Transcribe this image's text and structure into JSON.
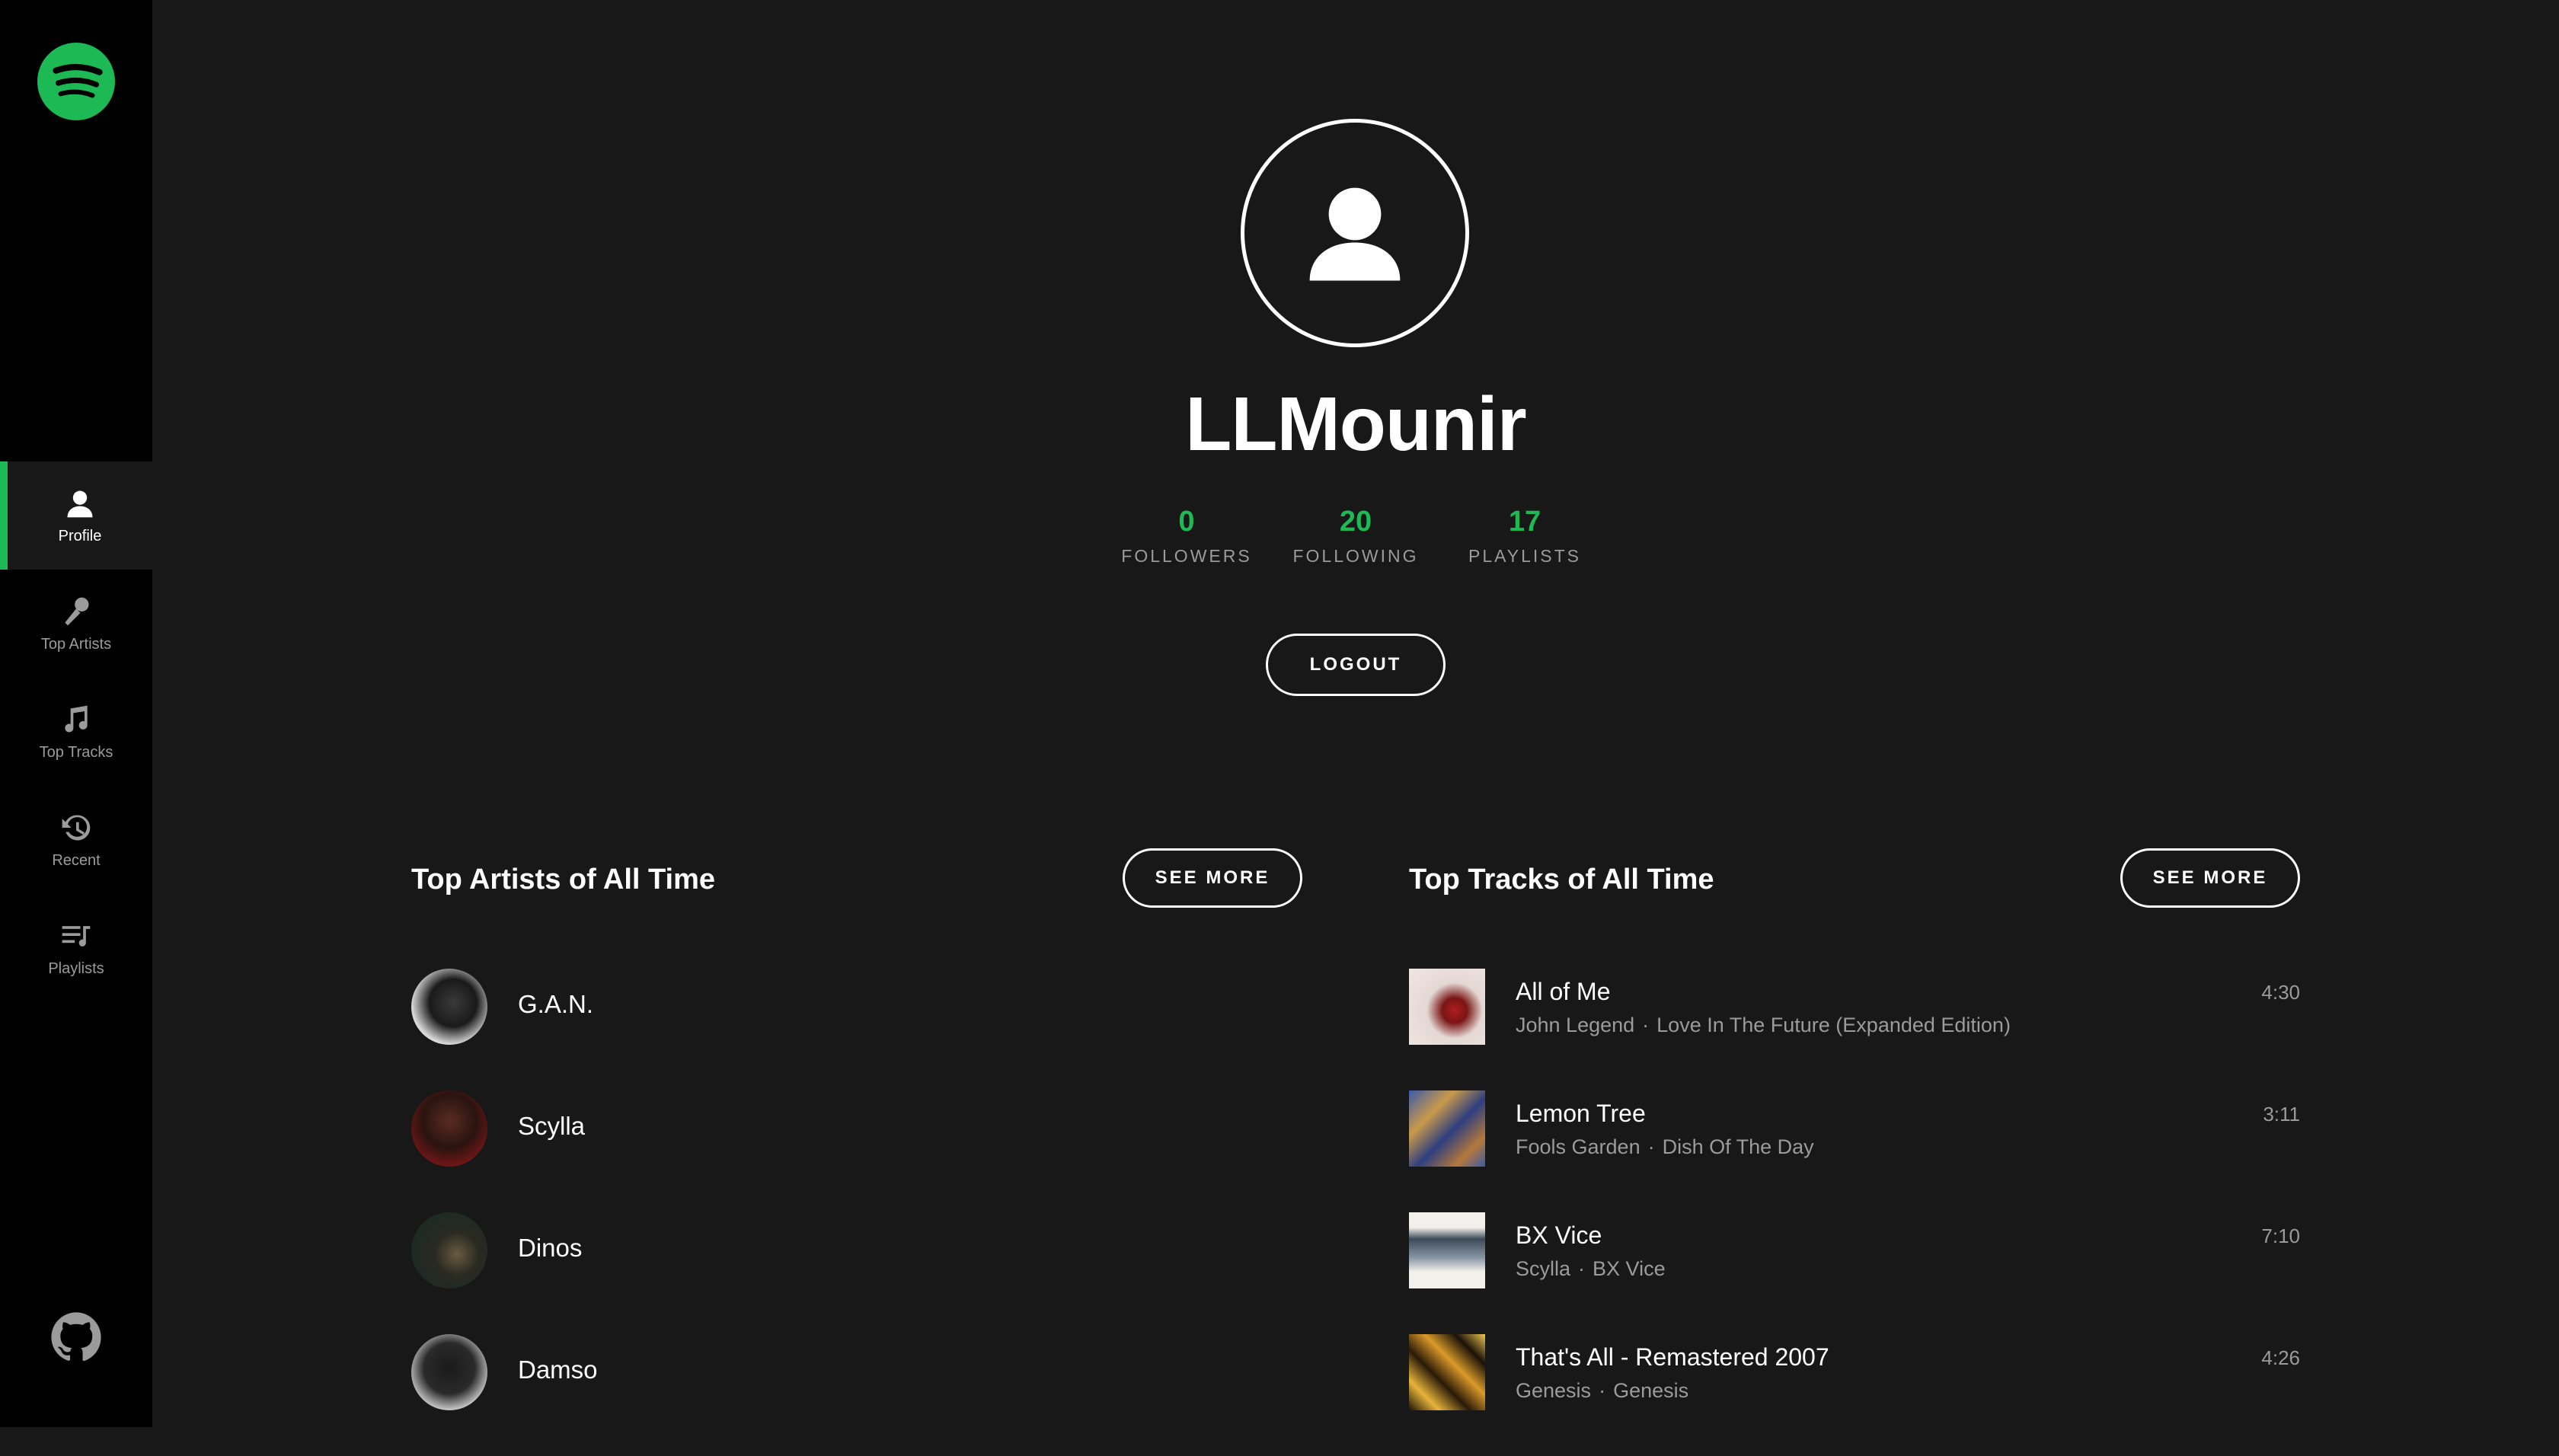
{
  "sidebar": {
    "items": [
      {
        "label": "Profile",
        "icon": "user-icon"
      },
      {
        "label": "Top Artists",
        "icon": "microphone-icon"
      },
      {
        "label": "Top Tracks",
        "icon": "music-note-icon"
      },
      {
        "label": "Recent",
        "icon": "history-icon"
      },
      {
        "label": "Playlists",
        "icon": "playlist-icon"
      }
    ]
  },
  "profile": {
    "username": "LLMounir",
    "stats": [
      {
        "value": "0",
        "label": "FOLLOWERS"
      },
      {
        "value": "20",
        "label": "FOLLOWING"
      },
      {
        "value": "17",
        "label": "PLAYLISTS"
      }
    ],
    "logout_label": "LOGOUT"
  },
  "top_artists": {
    "title": "Top Artists of All Time",
    "see_more": "SEE MORE",
    "items": [
      {
        "name": "G.A.N."
      },
      {
        "name": "Scylla"
      },
      {
        "name": "Dinos"
      },
      {
        "name": "Damso"
      }
    ]
  },
  "top_tracks": {
    "title": "Top Tracks of All Time",
    "see_more": "SEE MORE",
    "items": [
      {
        "name": "All of Me",
        "artist": "John Legend",
        "album": "Love In The Future (Expanded Edition)",
        "duration": "4:30"
      },
      {
        "name": "Lemon Tree",
        "artist": "Fools Garden",
        "album": "Dish Of The Day",
        "duration": "3:11"
      },
      {
        "name": "BX Vice",
        "artist": "Scylla",
        "album": "BX Vice",
        "duration": "7:10"
      },
      {
        "name": "That's All - Remastered 2007",
        "artist": "Genesis",
        "album": "Genesis",
        "duration": "4:26"
      }
    ]
  },
  "colors": {
    "accent": "#1db954",
    "background": "#181818",
    "sidebar": "#000000",
    "muted": "#9b9b9b"
  }
}
